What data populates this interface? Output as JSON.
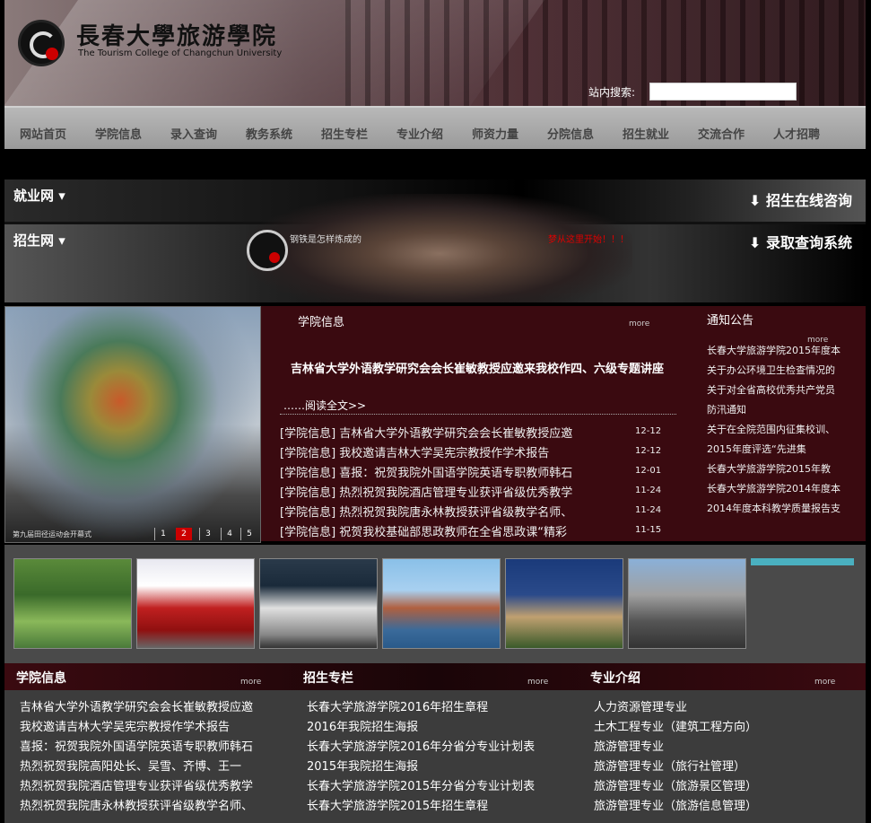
{
  "header": {
    "logo_cn": "長春大學旅游學院",
    "logo_en": "The Tourism College of Changchun University",
    "search_label": "站内搜索:",
    "search_value": ""
  },
  "nav": [
    "网站首页",
    "学院信息",
    "录入查询",
    "教务系统",
    "招生专栏",
    "专业介绍",
    "师资力量",
    "分院信息",
    "招生就业",
    "交流合作",
    "人才招聘"
  ],
  "banner": {
    "left_top": "就业网",
    "left_bottom": "招生网",
    "right_top": "招生在线咨询",
    "right_bottom": "录取查询系统",
    "slogan_left": "钢铁是怎样炼成的",
    "slogan_right": "梦从这里开始！！！"
  },
  "slideshow": {
    "caption": "第九届田径运动会开幕式",
    "pages": [
      "1",
      "2",
      "3",
      "4",
      "5"
    ],
    "active_page": "2"
  },
  "college_news": {
    "title": "学院信息",
    "more": "more",
    "headline": "吉林省大学外语教学研究会会长崔敏教授应邀来我校作四、六级专题讲座",
    "read_all": "……阅读全文>>",
    "items": [
      {
        "text": "[学院信息] 吉林省大学外语教学研究会会长崔敏教授应邀",
        "date": "12-12"
      },
      {
        "text": "[学院信息] 我校邀请吉林大学吴宪宗教授作学术报告",
        "date": "12-12"
      },
      {
        "text": "[学院信息] 喜报：祝贺我院外国语学院英语专职教师韩石",
        "date": "12-01"
      },
      {
        "text": "[学院信息] 热烈祝贺我院酒店管理专业获评省级优秀教学",
        "date": "11-24"
      },
      {
        "text": "[学院信息] 热烈祝贺我院唐永林教授获评省级教学名师、",
        "date": "11-24"
      },
      {
        "text": "[学院信息] 祝贺我校基础部思政教师在全省思政课“精彩",
        "date": "11-15"
      }
    ]
  },
  "notices": {
    "title": "通知公告",
    "more": "more",
    "items": [
      "长春大学旅游学院2015年度本",
      "关于办公环境卫生检查情况的",
      "关于对全省高校优秀共产党员",
      "防汛通知",
      "关于在全院范围内征集校训、",
      "2015年度评选“先进集",
      "长春大学旅游学院2015年教",
      "长春大学旅游学院2014年度本",
      "2014年度本科教学质量报告支"
    ]
  },
  "bottom": {
    "more": "more",
    "col1": {
      "title": "学院信息",
      "items": [
        "吉林省大学外语教学研究会会长崔敏教授应邀",
        "我校邀请吉林大学吴宪宗教授作学术报告",
        "喜报：祝贺我院外国语学院英语专职教师韩石",
        "热烈祝贺我院高阳处长、吴雪、齐博、王一",
        "热烈祝贺我院酒店管理专业获评省级优秀教学",
        "热烈祝贺我院唐永林教授获评省级教学名师、"
      ]
    },
    "col2": {
      "title": "招生专栏",
      "items": [
        "长春大学旅游学院2016年招生章程",
        "2016年我院招生海报",
        "长春大学旅游学院2016年分省分专业计划表",
        "2015年我院招生海报",
        "长春大学旅游学院2015年分省分专业计划表",
        "长春大学旅游学院2015年招生章程"
      ]
    },
    "col3": {
      "title": "专业介绍",
      "items": [
        "人力资源管理专业",
        "土木工程专业（建筑工程方向）",
        "旅游管理专业",
        "旅游管理专业（旅行社管理）",
        "旅游管理专业（旅游景区管理）",
        "旅游管理专业（旅游信息管理）"
      ]
    }
  },
  "colors": {
    "accent": "#3a0a10",
    "nav_bg": "#a8a8a8",
    "bullet": "#e0c000"
  }
}
